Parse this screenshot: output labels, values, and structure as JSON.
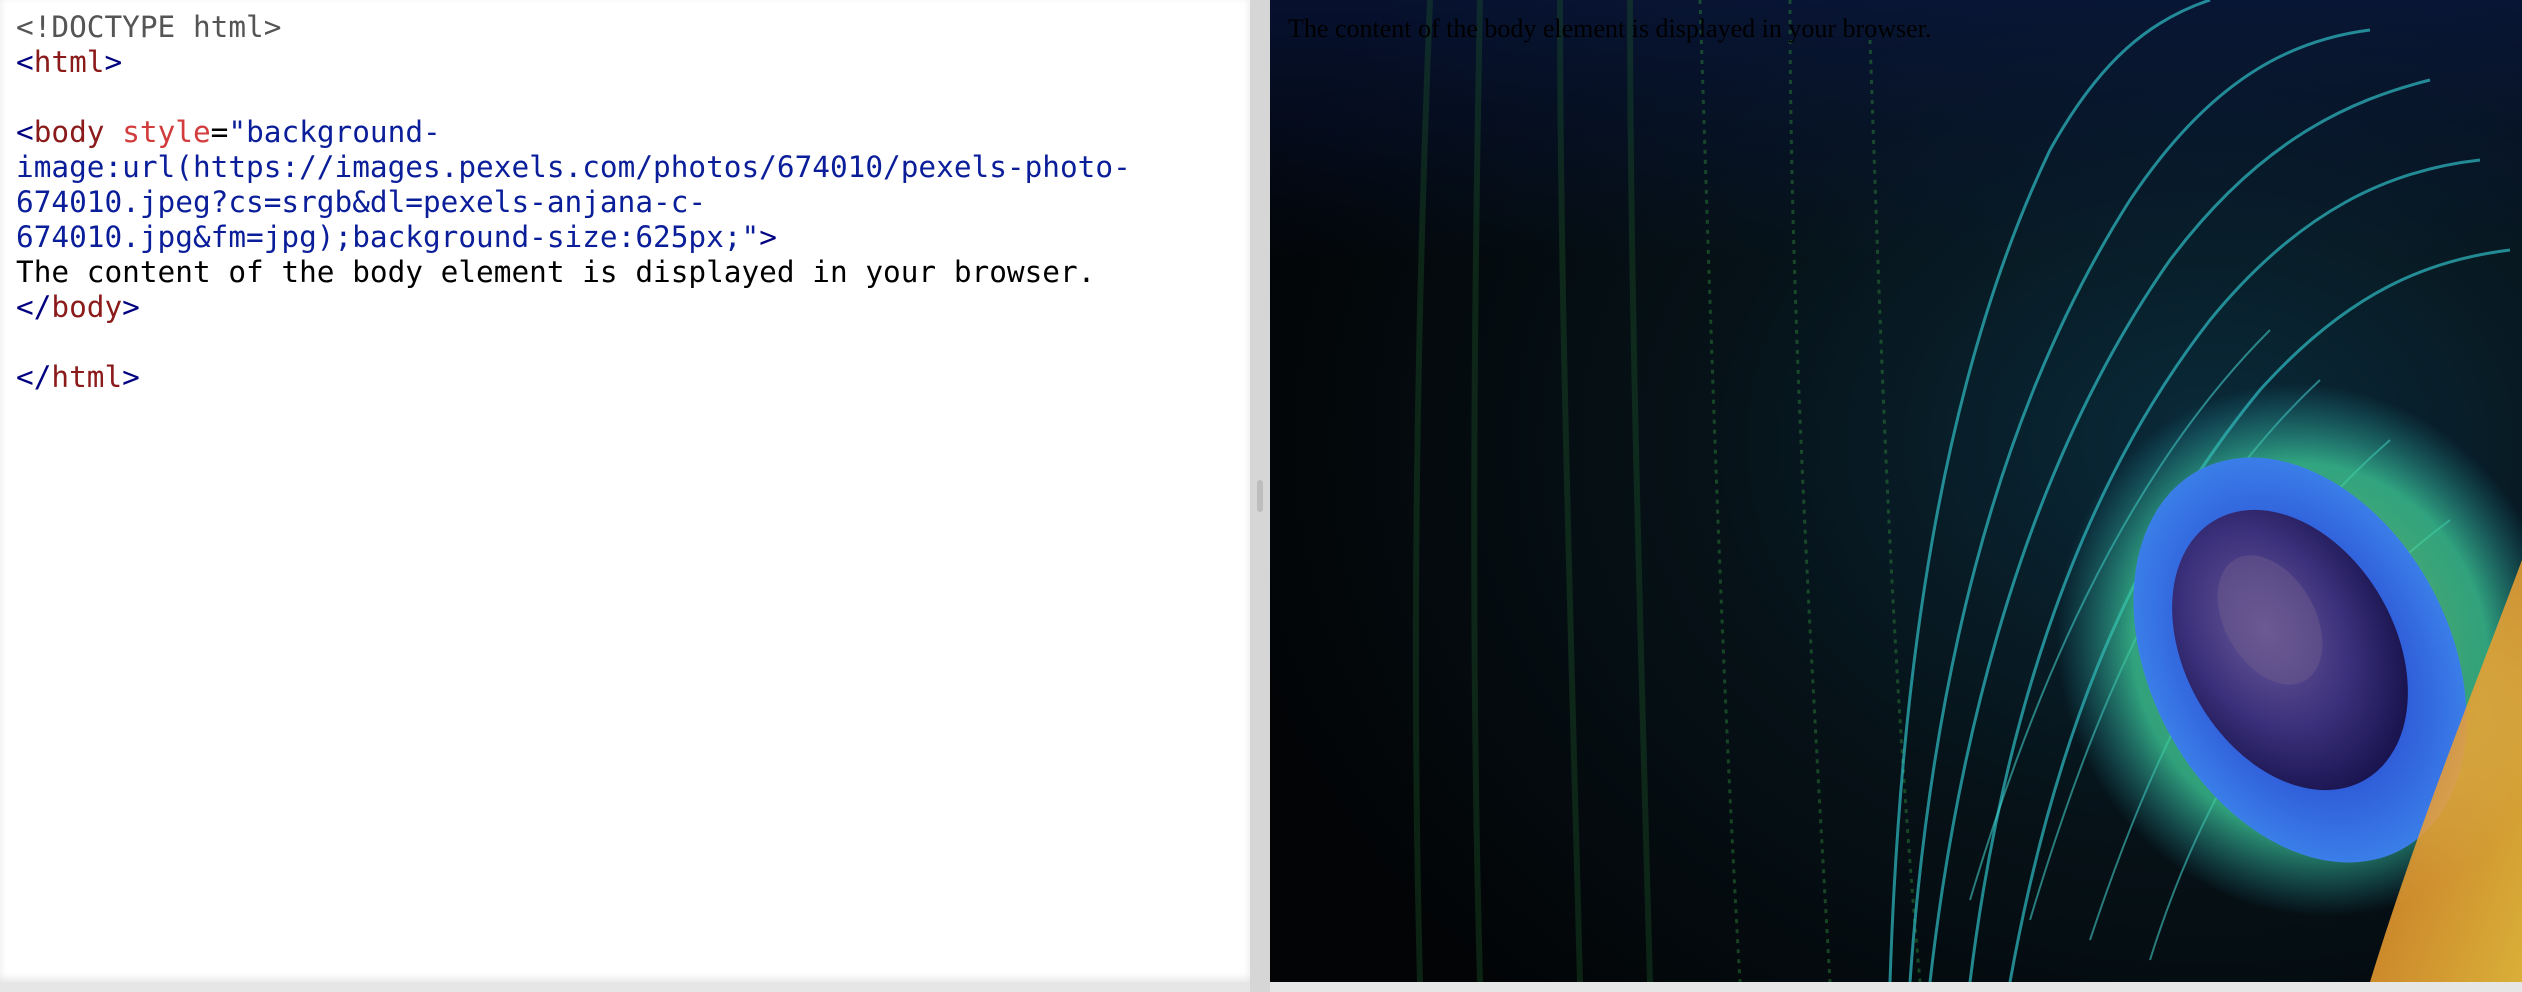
{
  "editor": {
    "lines": [
      [
        {
          "t": "<!DOCTYPE html>",
          "c": "doctype"
        }
      ],
      [
        {
          "t": "<",
          "c": "punct"
        },
        {
          "t": "html",
          "c": "tag"
        },
        {
          "t": ">",
          "c": "punct"
        }
      ],
      [],
      [
        {
          "t": "<",
          "c": "punct"
        },
        {
          "t": "body",
          "c": "tag"
        },
        {
          "t": " ",
          "c": "text"
        },
        {
          "t": "style",
          "c": "attr"
        },
        {
          "t": "=",
          "c": "eq"
        },
        {
          "t": "\"background-",
          "c": "val"
        }
      ],
      [
        {
          "t": "image:url(https://images.pexels.com/photos/674010/pexels-photo-",
          "c": "val"
        }
      ],
      [
        {
          "t": "674010.jpeg?cs=srgb&dl=pexels-anjana-c-",
          "c": "val"
        }
      ],
      [
        {
          "t": "674010.jpg&fm=jpg);background-size:625px;\"",
          "c": "val"
        },
        {
          "t": ">",
          "c": "punct"
        }
      ],
      [
        {
          "t": "The content of the body element is displayed in your browser.",
          "c": "text"
        }
      ],
      [
        {
          "t": "</",
          "c": "punct"
        },
        {
          "t": "body",
          "c": "tag"
        },
        {
          "t": ">",
          "c": "punct"
        }
      ],
      [],
      [
        {
          "t": "</",
          "c": "punct"
        },
        {
          "t": "html",
          "c": "tag"
        },
        {
          "t": ">",
          "c": "punct"
        }
      ]
    ]
  },
  "preview": {
    "body_text": "The content of the body element is displayed in your browser.",
    "background_image": "peacock-feather-photo"
  },
  "colors": {
    "doctype": "#555555",
    "punct": "#000080",
    "tag": "#8b1a1a",
    "attr": "#d23c3c",
    "value": "#0b1e9a",
    "text": "#000000"
  }
}
